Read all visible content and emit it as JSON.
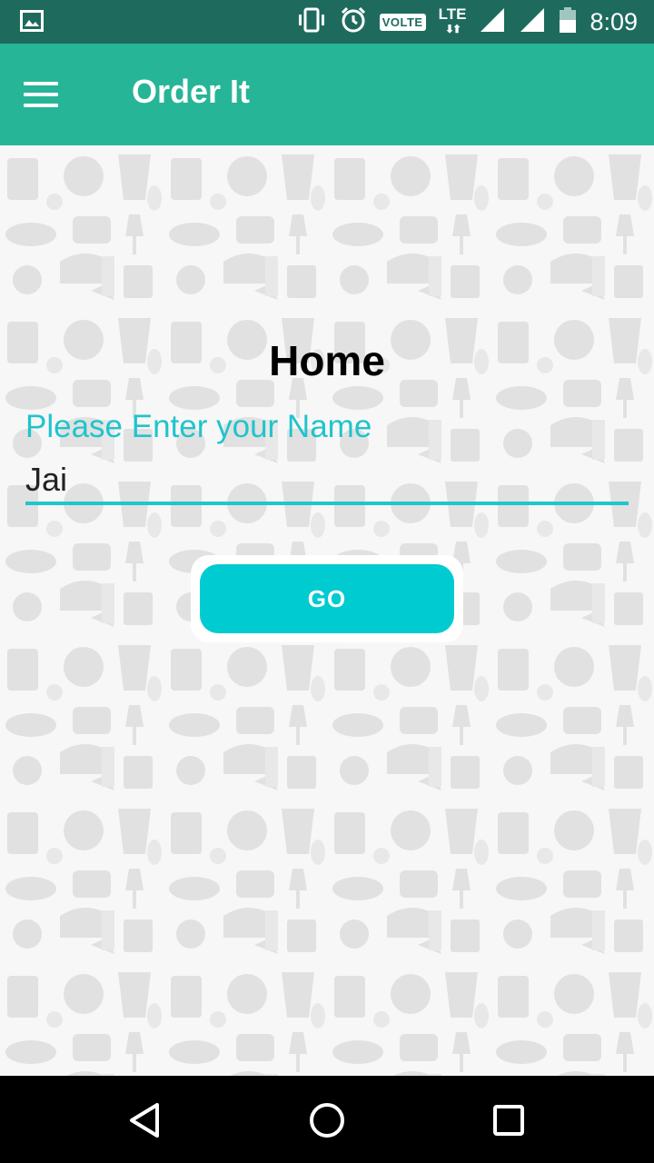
{
  "status_bar": {
    "time": "8:09",
    "volte": "VOLTE",
    "lte": "LTE",
    "icons": [
      "image-icon",
      "vibrate-icon",
      "alarm-icon",
      "volte-icon",
      "lte-icon",
      "signal-icon",
      "signal-icon",
      "battery-icon"
    ]
  },
  "app_bar": {
    "title": "Order It",
    "menu_icon": "hamburger-menu-icon",
    "color": "#26b597"
  },
  "main": {
    "heading": "Home",
    "name_field": {
      "label": "Please Enter your Name",
      "value": "Jai"
    },
    "go_button": "GO",
    "accent": "#1fc6cd",
    "button_color": "#00cbd1"
  },
  "nav_bar": {
    "icons": [
      "back-icon",
      "home-icon",
      "recents-icon"
    ]
  }
}
